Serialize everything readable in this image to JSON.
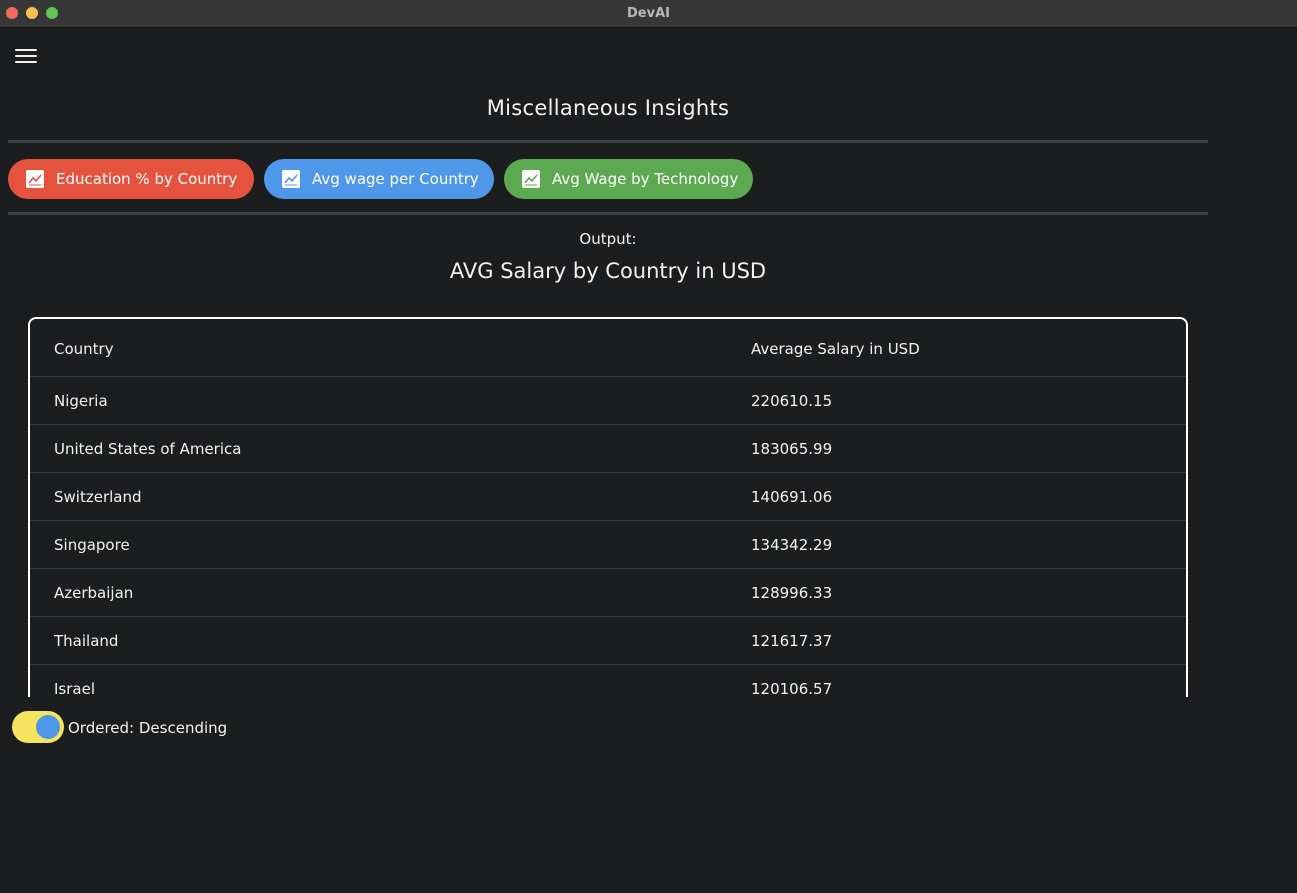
{
  "window": {
    "title": "DevAI"
  },
  "page": {
    "title": "Miscellaneous Insights",
    "output_label": "Output:"
  },
  "tabs": [
    {
      "label": "Education % by Country",
      "color": "#e5533f",
      "icon": "chart-icon"
    },
    {
      "label": "Avg wage per Country",
      "color": "#4f97e8",
      "icon": "chart-icon"
    },
    {
      "label": "Avg Wage by Technology",
      "color": "#5da952",
      "icon": "chart-icon"
    }
  ],
  "table": {
    "title": "AVG Salary by Country in USD",
    "columns": [
      "Country",
      "Average Salary in USD"
    ],
    "rows": [
      [
        "Nigeria",
        "220610.15"
      ],
      [
        "United States of America",
        "183065.99"
      ],
      [
        "Switzerland",
        "140691.06"
      ],
      [
        "Singapore",
        "134342.29"
      ],
      [
        "Azerbaijan",
        "128996.33"
      ],
      [
        "Thailand",
        "121617.37"
      ],
      [
        "Israel",
        "120106.57"
      ]
    ]
  },
  "order_toggle": {
    "label": "Ordered: Descending",
    "on": true
  },
  "colors": {
    "background": "#1c1d1f",
    "toggle_track": "#f7e45e",
    "toggle_knob": "#4f97e8"
  }
}
